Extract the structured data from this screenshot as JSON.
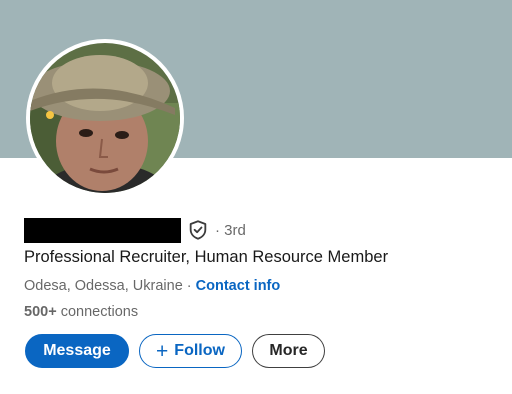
{
  "profile": {
    "degree": "· 3rd",
    "headline": "Professional Recruiter, Human Resource Member",
    "location": "Odesa, Odessa, Ukraine",
    "separator": " · ",
    "contact_info": "Contact info",
    "connections_count": "500+",
    "connections_label": " connections",
    "verification_icon": "shield-check-icon"
  },
  "actions": {
    "message": "Message",
    "follow_plus": "+",
    "follow": "Follow",
    "more": "More"
  },
  "colors": {
    "cover": "#a0b4b7",
    "accent": "#0a66c2"
  }
}
